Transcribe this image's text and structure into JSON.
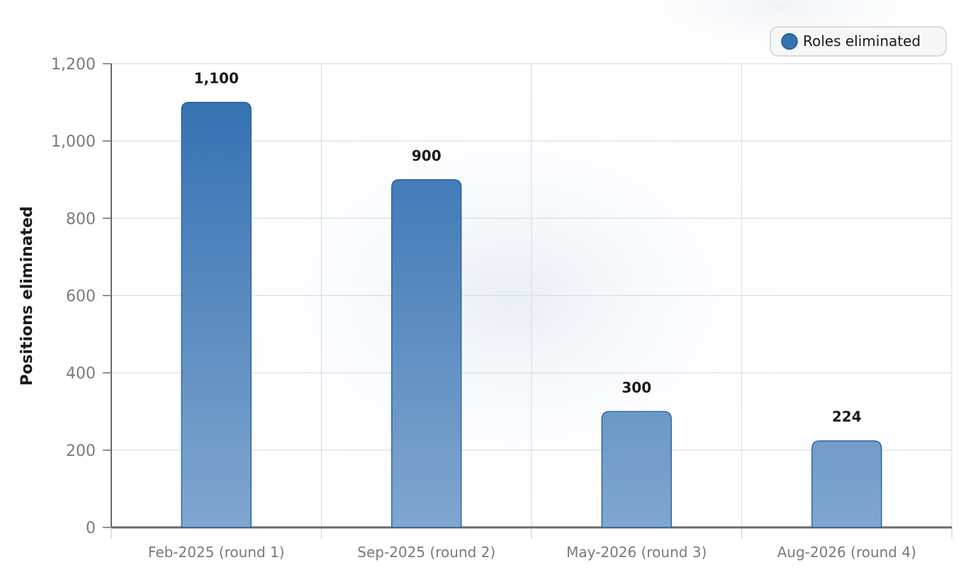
{
  "chart_data": {
    "type": "bar",
    "categories": [
      "Feb-2025 (round 1)",
      "Sep-2025 (round 2)",
      "May-2026 (round 3)",
      "Aug-2026 (round 4)"
    ],
    "series": [
      {
        "name": "Roles eliminated",
        "values": [
          1100,
          900,
          300,
          224
        ],
        "data_labels": [
          "1,100",
          "900",
          "300",
          "224"
        ],
        "color": "#3572b0"
      }
    ],
    "ylabel": "Positions eliminated",
    "xlabel": "",
    "ylim": [
      0,
      1200
    ],
    "yticks": [
      0,
      200,
      400,
      600,
      800,
      1000,
      1200
    ],
    "ytick_labels": [
      "0",
      "200",
      "400",
      "600",
      "800",
      "1,000",
      "1,200"
    ],
    "grid": true,
    "legend_position": "top-right"
  }
}
